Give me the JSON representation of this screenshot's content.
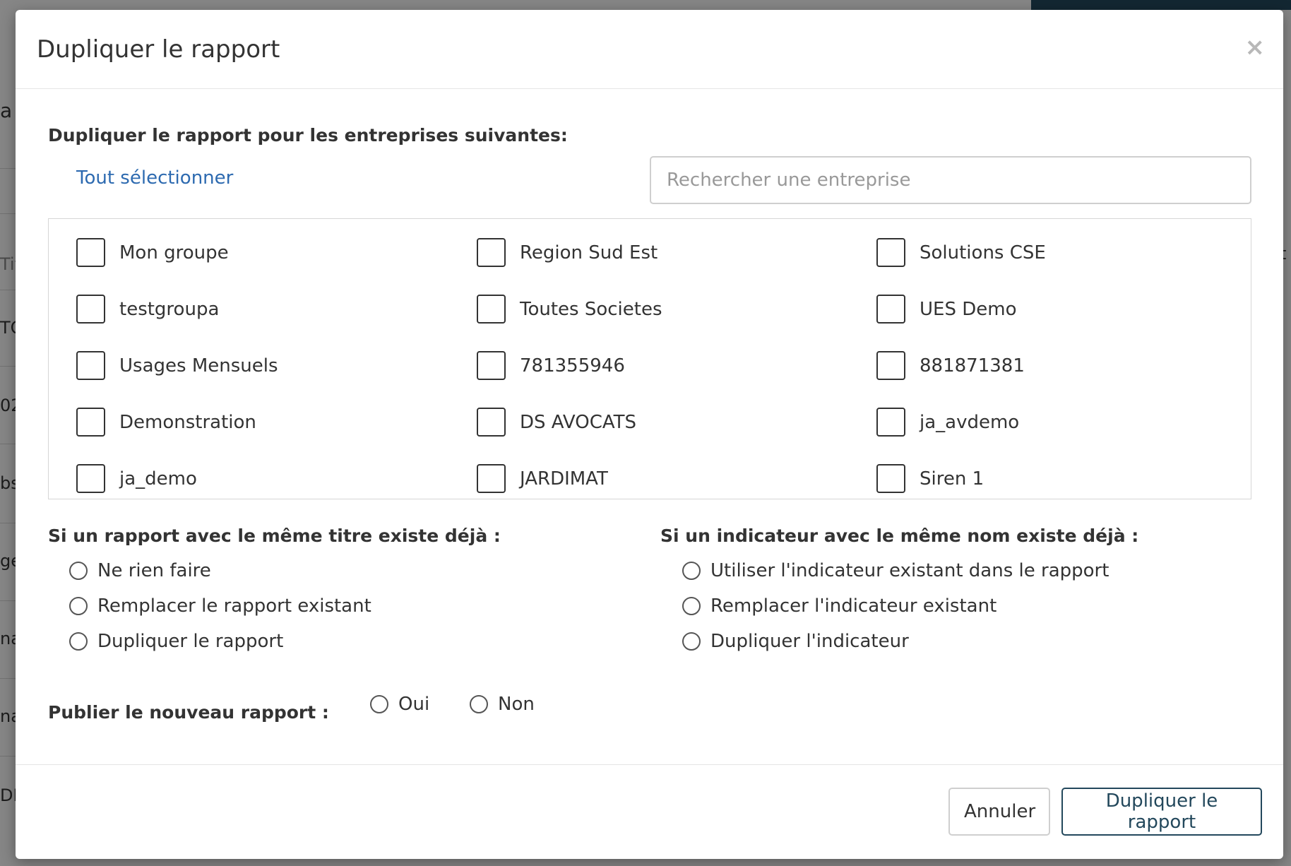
{
  "background": {
    "left_fragments": [
      "a",
      "Tit",
      "TO",
      "02",
      "bs",
      "ge",
      "na",
      "na",
      "DE"
    ],
    "right_fragments": [
      "t"
    ]
  },
  "modal": {
    "title": "Dupliquer le rapport",
    "close_glyph": "×"
  },
  "companies": {
    "heading": "Dupliquer le rapport pour les entreprises suivantes:",
    "select_all": "Tout sélectionner",
    "search_placeholder": "Rechercher une entreprise",
    "items": [
      {
        "label": "Mon groupe",
        "checked": false
      },
      {
        "label": "Region Sud Est",
        "checked": false
      },
      {
        "label": "Solutions CSE",
        "checked": false
      },
      {
        "label": "testgroupa",
        "checked": false
      },
      {
        "label": "Toutes Societes",
        "checked": false
      },
      {
        "label": "UES Demo",
        "checked": false
      },
      {
        "label": "Usages Mensuels",
        "checked": false
      },
      {
        "label": "781355946",
        "checked": false
      },
      {
        "label": "881871381",
        "checked": false
      },
      {
        "label": "Demonstration",
        "checked": false
      },
      {
        "label": "DS AVOCATS",
        "checked": false
      },
      {
        "label": "ja_avdemo",
        "checked": false
      },
      {
        "label": "ja_demo",
        "checked": false
      },
      {
        "label": "JARDIMAT",
        "checked": false
      },
      {
        "label": "Siren 1",
        "checked": false
      }
    ]
  },
  "report_conflict": {
    "heading": "Si un rapport avec le même titre existe déjà :",
    "options": [
      "Ne rien faire",
      "Remplacer le rapport existant",
      "Dupliquer le rapport"
    ]
  },
  "indicator_conflict": {
    "heading": "Si un indicateur avec le même nom existe déjà :",
    "options": [
      "Utiliser l'indicateur existant dans le rapport",
      "Remplacer l'indicateur existant",
      "Dupliquer l'indicateur"
    ]
  },
  "publish": {
    "heading": "Publier le nouveau rapport :",
    "options": [
      "Oui",
      "Non"
    ]
  },
  "footer": {
    "cancel_label": "Annuler",
    "submit_label": "Dupliquer le rapport"
  },
  "colors": {
    "link": "#2d6ab0",
    "primary": "#23485c"
  }
}
